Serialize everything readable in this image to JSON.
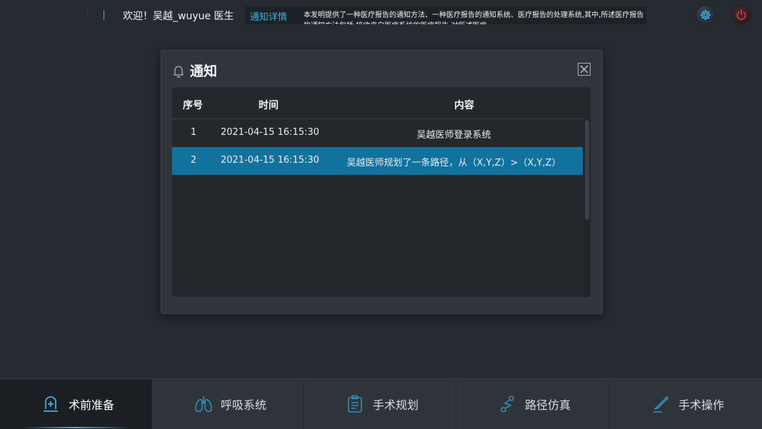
{
  "header": {
    "welcome": "欢迎！吴越_wuyue 医生",
    "notice_link": "通知详情",
    "notice_text": "本发明提供了一种医疗报告的通知方法、一种医疗报告的通知系统、医疗报告的处理系统,其中,所述医疗报告的通知方法包括:接收来自医疗系统的医疗报告,对所述医疗",
    "settings_icon": "gear-icon",
    "power_icon": "power-icon"
  },
  "modal": {
    "title": "通知",
    "title_icon": "bell-icon",
    "close_icon": "close-icon",
    "columns": [
      "序号",
      "时间",
      "内容"
    ],
    "rows": [
      {
        "index": "1",
        "time": "2021-04-15 16:15:30",
        "content": "吴越医师登录系统"
      },
      {
        "index": "2",
        "time": "2021-04-15 16:15:30",
        "content": "吴越医师规划了一条路径，从（X,Y,Z）>（X,Y,Z）"
      }
    ],
    "selected_row": 2
  },
  "nav": {
    "tabs": [
      {
        "label": "术前准备",
        "icon": "monitor-plus-icon",
        "active": true
      },
      {
        "label": "呼吸系统",
        "icon": "lungs-icon",
        "active": false
      },
      {
        "label": "手术规划",
        "icon": "clipboard-icon",
        "active": false
      },
      {
        "label": "路径仿真",
        "icon": "path-link-icon",
        "active": false
      },
      {
        "label": "手术操作",
        "icon": "scalpel-icon",
        "active": false
      }
    ]
  },
  "colors": {
    "accent": "#3fb1e3",
    "selected_row": "#12729e",
    "background": "#262b31",
    "power_red": "#d9363e"
  }
}
